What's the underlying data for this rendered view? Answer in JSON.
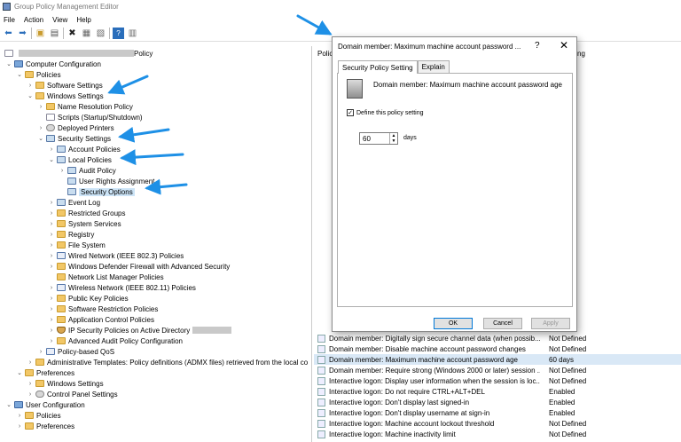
{
  "window": {
    "title": "Group Policy Management Editor"
  },
  "menu": [
    "File",
    "Action",
    "View",
    "Help"
  ],
  "toolbar_icons": [
    "back-icon",
    "forward-icon",
    "up-folder-icon",
    "show-hide-tree-icon",
    "delete-icon",
    "properties-icon",
    "export-icon",
    "help-icon",
    "view-icon"
  ],
  "tree": {
    "root_label": "Policy",
    "computer_configuration": "Computer Configuration",
    "policies": "Policies",
    "software_settings": "Software Settings",
    "windows_settings": "Windows Settings",
    "name_resolution_policy": "Name Resolution Policy",
    "scripts": "Scripts (Startup/Shutdown)",
    "deployed_printers": "Deployed Printers",
    "security_settings": "Security Settings",
    "account_policies": "Account Policies",
    "local_policies": "Local Policies",
    "audit_policy": "Audit Policy",
    "user_rights_assignment": "User Rights Assignment",
    "security_options": "Security Options",
    "event_log": "Event Log",
    "restricted_groups": "Restricted Groups",
    "system_services": "System Services",
    "registry": "Registry",
    "file_system": "File System",
    "wired_network": "Wired Network (IEEE 802.3) Policies",
    "firewall": "Windows Defender Firewall with Advanced Security",
    "network_list": "Network List Manager Policies",
    "wireless_network": "Wireless Network (IEEE 802.11) Policies",
    "public_key": "Public Key Policies",
    "software_restriction": "Software Restriction Policies",
    "application_control": "Application Control Policies",
    "ip_security": "IP Security Policies on Active Directory",
    "advanced_audit": "Advanced Audit Policy Configuration",
    "policy_qos": "Policy-based QoS",
    "admin_templates": "Administrative Templates: Policy definitions (ADMX files) retrieved from the local co",
    "preferences": "Preferences",
    "pref_windows_settings": "Windows Settings",
    "control_panel_settings": "Control Panel Settings",
    "user_configuration": "User Configuration",
    "user_policies": "Policies",
    "user_preferences": "Preferences"
  },
  "list": {
    "col_policy": "Polic",
    "col_setting": "ng",
    "rows": [
      {
        "name": "Domain member: Digitally sign secure channel data (when possib...",
        "value": "Not Defined"
      },
      {
        "name": "Domain member: Disable machine account password changes",
        "value": "Not Defined"
      },
      {
        "name": "Domain member: Maximum machine account password age",
        "value": "60 days"
      },
      {
        "name": "Domain member: Require strong (Windows 2000 or later) session ...",
        "value": "Not Defined"
      },
      {
        "name": "Interactive logon: Display user information when the session is loc...",
        "value": "Not Defined"
      },
      {
        "name": "Interactive logon: Do not require CTRL+ALT+DEL",
        "value": "Enabled"
      },
      {
        "name": "Interactive logon: Don't display last signed-in",
        "value": "Enabled"
      },
      {
        "name": "Interactive logon: Don't display username at sign-in",
        "value": "Enabled"
      },
      {
        "name": "Interactive logon: Machine account lockout threshold",
        "value": "Not Defined"
      },
      {
        "name": "Interactive logon: Machine inactivity limit",
        "value": "Not Defined"
      }
    ]
  },
  "dialog": {
    "title": "Domain member: Maximum machine account password ...",
    "help_glyph": "?",
    "close_glyph": "✕",
    "tab_setting": "Security Policy Setting",
    "tab_explain": "Explain",
    "policy_name": "Domain member: Maximum machine account password age",
    "checkbox_label": "Define this policy setting",
    "checkbox_mark": "✓",
    "value": "60",
    "unit": "days",
    "ok": "OK",
    "cancel": "Cancel",
    "apply": "Apply"
  },
  "annotation_color": "#1e90e6"
}
